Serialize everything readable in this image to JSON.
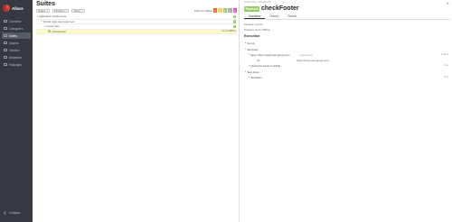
{
  "app": {
    "name": "Allure"
  },
  "sidebar": {
    "items": [
      {
        "label": "Overview",
        "icon": "overview-icon"
      },
      {
        "label": "Categories",
        "icon": "categories-icon"
      },
      {
        "label": "Suites",
        "icon": "suites-icon",
        "active": true
      },
      {
        "label": "Graphs",
        "icon": "graphs-icon"
      },
      {
        "label": "Timeline",
        "icon": "timeline-icon"
      },
      {
        "label": "Behaviors",
        "icon": "behaviors-icon"
      },
      {
        "label": "Packages",
        "icon": "packages-icon"
      }
    ],
    "collapse_label": "Collapse"
  },
  "main": {
    "title": "Suites",
    "filters": [
      {
        "label": "Status",
        "value": "1"
      },
      {
        "label": "Duration",
        "value": "1"
      },
      {
        "label": "Name",
        "value": "1"
      }
    ],
    "status_filter_label": "Filter by status",
    "status_counts": [
      {
        "value": "0",
        "color": "#fd5a3e"
      },
      {
        "value": "0",
        "color": "#ffd050"
      },
      {
        "value": "1",
        "color": "#97cc64"
      },
      {
        "value": "0",
        "color": "#aaaaaa"
      },
      {
        "value": "0",
        "color": "#d35ebe"
      }
    ],
    "tree": [
      {
        "label": "application stories suite",
        "count": "1",
        "indent": 0
      },
      {
        "label": "Shrutik Ingle site footer test",
        "count": "1",
        "indent": 1
      },
      {
        "label": "Footer Test",
        "count": "1",
        "indent": 2
      },
      {
        "label": "checkFooter",
        "duration": "1m 2s 885ms",
        "indent": 3,
        "selected": true
      }
    ]
  },
  "panel": {
    "breadcrumb": "Footer Test > checkFooter",
    "status_badge": "Passed",
    "test_name": "checkFooter",
    "tabs": [
      "Overview",
      "History",
      "Retries"
    ],
    "severity": "Severity: normal",
    "duration": "Duration: 2s 1m 885ms",
    "execution_title": "Execution",
    "steps": [
      {
        "label": "Set up",
        "time": "",
        "indent": 0
      },
      {
        "label": "Test body",
        "time": "",
        "indent": 0
      },
      {
        "label": "Open https://www.navi-group.com",
        "time": "2s 0ms",
        "indent": 1,
        "extra": "1 parameter"
      },
      {
        "label": "url",
        "time": "",
        "indent": 2,
        "extra": "https://www.navi-group.com/"
      },
      {
        "label": "Check the footer is visible",
        "time": "0ms",
        "indent": 1
      },
      {
        "label": "Tear down",
        "time": "",
        "indent": 0
      },
      {
        "label": "Teardown",
        "time": "0ms",
        "indent": 1
      }
    ]
  }
}
